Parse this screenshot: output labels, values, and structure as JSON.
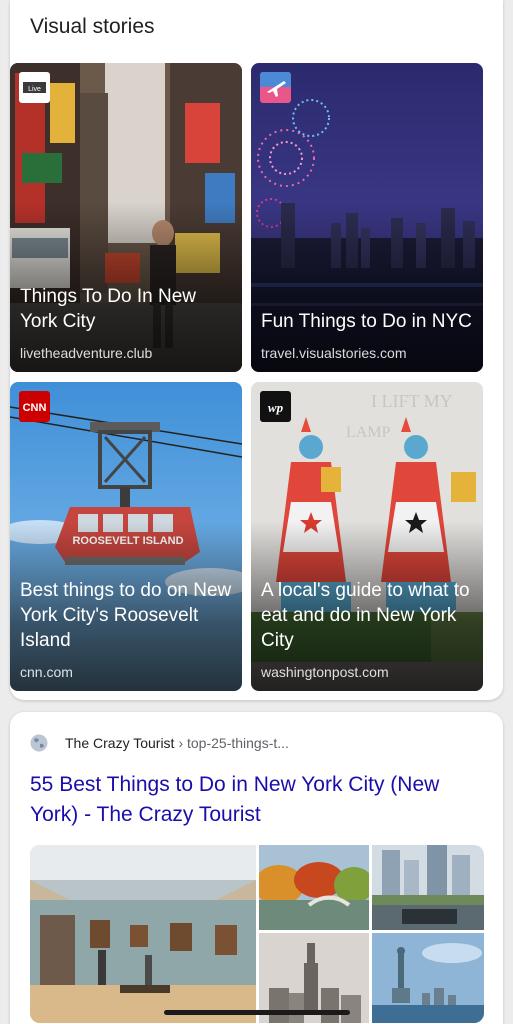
{
  "visual_stories": {
    "title": "Visual stories",
    "stories": [
      {
        "headline": "Things To Do In New York City",
        "source": "livetheadventure.club",
        "logo": "live-the-adventure-logo"
      },
      {
        "headline": "Fun Things to Do in NYC",
        "source": "travel.visualstories.com",
        "logo": "airplane-icon"
      },
      {
        "headline": "Best things to do on New York City's Roosevelt Island",
        "source": "cnn.com",
        "logo": "CNN"
      },
      {
        "headline": "A local's guide to what to eat and do in New York City",
        "source": "washingtonpost.com",
        "logo": "wp"
      }
    ]
  },
  "result": {
    "site_name": "The Crazy Tourist",
    "breadcrumb": "› top-25-things-t...",
    "title": "55 Best Things to Do in New York City (New York) - The Crazy Tourist",
    "images": [
      "museum-gallery",
      "central-park-autumn",
      "9-11-memorial",
      "empire-state-skyline",
      "statue-of-liberty"
    ]
  },
  "colors": {
    "link": "#1a0dab",
    "text": "#202124",
    "muted": "#5f6368",
    "cnn_red": "#cc0000"
  }
}
